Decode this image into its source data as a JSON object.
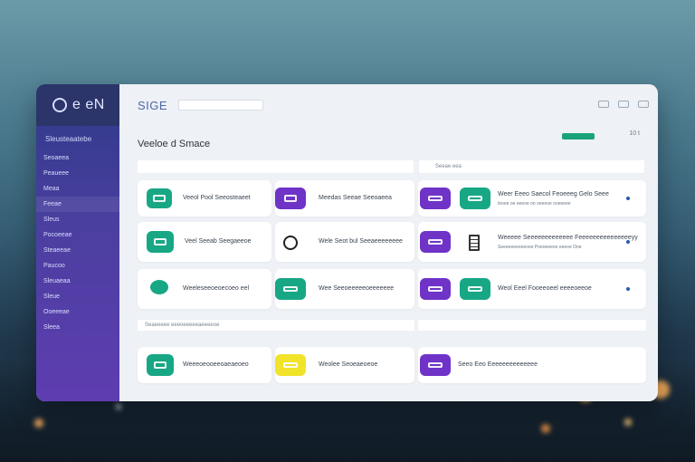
{
  "app": {
    "brand_text": "e eN"
  },
  "sidebar": {
    "heading": "Sleusteaatebe",
    "items": [
      {
        "label": "Seoaeea"
      },
      {
        "label": "Peaueee"
      },
      {
        "label": "Meaa"
      },
      {
        "label": "Feeae"
      },
      {
        "label": "Sleus"
      },
      {
        "label": "Pocoeeae"
      },
      {
        "label": "Steaeeae"
      },
      {
        "label": "Paucoo"
      },
      {
        "label": "Sleuaeaa"
      },
      {
        "label": "Sleue"
      },
      {
        "label": "Ooeeeae"
      },
      {
        "label": "Sleea"
      }
    ]
  },
  "topbar": {
    "logo_text": "SIGE",
    "search_placeholder": ""
  },
  "page": {
    "title": "Veeloe d Smace",
    "meta": "10 t"
  },
  "filters": {
    "right_label": "Seeae eea"
  },
  "cards": [
    {
      "row": 1,
      "items": [
        {
          "label": "Veeol Pool Seeosteaeet",
          "icon_color": "green",
          "icon": "server-icon"
        },
        {
          "label": "Meedas Seeae Seeoaeea",
          "icon_color": "purple",
          "icon": "box-icon"
        },
        {
          "label": "Weer Eeeo  Saecol Feoeeeg  Gelo Seee",
          "icon_color": "purple",
          "icon": "rack-icon",
          "sub": "Ieoee oe eeeoe oo oeeeoe ooeeeee"
        }
      ]
    },
    {
      "row": 2,
      "items": [
        {
          "label": "Veel Seeab Seegaeeoe",
          "icon_color": "green",
          "icon": "server-icon"
        },
        {
          "label": "Wele Seot bul Seeaeeeeeeee",
          "icon_color": "none",
          "icon": "circle-outline-icon"
        },
        {
          "label": "Weeeee Seeeeeeeeeeeee Feeeeeeeeeeeeeeeyy",
          "icon_color": "purple",
          "icon": "slope-icon",
          "sub": "Seeeeeeeoeeooe Poeoeeeoo eeeoe Ooe"
        }
      ]
    },
    {
      "row": 3,
      "items": [
        {
          "label": "Weeleseeoeoecoeo eel",
          "icon_color": "green",
          "icon": "circle-icon"
        },
        {
          "label": "Wee Seeoeeeeeoeeeeeee",
          "icon_color": "green",
          "icon": "slope-icon"
        },
        {
          "label": "Weol Eeel Fooeeoeel eeeeoeeoe",
          "icon_color": "purple",
          "icon": "slope-icon"
        }
      ]
    },
    {
      "row": 4,
      "items": [
        {
          "label": "Weeeoeooeeoaeaeoeo",
          "icon_color": "green",
          "icon": "server-icon"
        },
        {
          "label": "Weolee Seoeaeoeoe",
          "icon_color": "yellow",
          "icon": "slope-icon"
        },
        {
          "label": "Seeo Eeo Eeeeeeeeeeeeee",
          "icon_color": "purple",
          "icon": "slope-icon"
        }
      ]
    }
  ],
  "strip": {
    "text": "Seaeeeee eeeoeeeeeaeeeeoe"
  }
}
